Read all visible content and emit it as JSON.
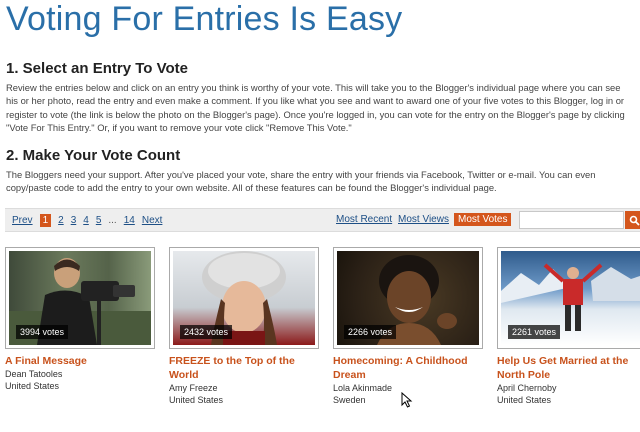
{
  "header": {
    "title": "Voting For Entries Is Easy"
  },
  "sections": [
    {
      "heading": "1. Select an Entry To Vote",
      "text": "Review the entries below and click on an entry you think is worthy of your vote. This will take you to the Blogger's individual page where you can see his or her photo, read the entry and even make a comment.  If you like what you see and want to award one of your five votes to this Blogger, log in or register to vote (the link is below the photo on the Blogger's page).  Once you're logged in, you can vote for the entry on the Blogger's page by clicking \"Vote For This Entry.\"  Or, if you want to remove your vote click \"Remove This Vote.\""
    },
    {
      "heading": "2. Make Your Vote Count",
      "text": "The Bloggers need your support.  After you've placed your vote, share the entry with your friends via Facebook, Twitter or e-mail.  You can even copy/paste code to add the entry to your own website.  All of these features can be found the Blogger's individual page."
    }
  ],
  "pager": {
    "prev": "Prev",
    "current": "1",
    "pages": [
      "2",
      "3",
      "4",
      "5"
    ],
    "ellipsis": "...",
    "last": "14",
    "next": "Next"
  },
  "sort": {
    "most_recent": "Most Recent",
    "most_views": "Most Views",
    "most_votes": "Most Votes",
    "active": "most_votes"
  },
  "search": {
    "placeholder": "",
    "button_icon": "search-icon"
  },
  "colors": {
    "accent": "#d4561c",
    "title_blue": "#2a6fa8",
    "link": "#c8521c"
  },
  "entries": [
    {
      "votes": "3994 votes",
      "title": "A Final Message",
      "author": "Dean Tatooles",
      "country": "United States"
    },
    {
      "votes": "2432 votes",
      "title": "FREEZE to the Top of the World",
      "author": "Amy Freeze",
      "country": "United States"
    },
    {
      "votes": "2266 votes",
      "title": "Homecoming: A Childhood Dream",
      "author": "Lola Akinmade",
      "country": "Sweden"
    },
    {
      "votes": "2261 votes",
      "title": "Help Us Get Married at the North Pole",
      "author": "April Chernoby",
      "country": "United States"
    }
  ]
}
